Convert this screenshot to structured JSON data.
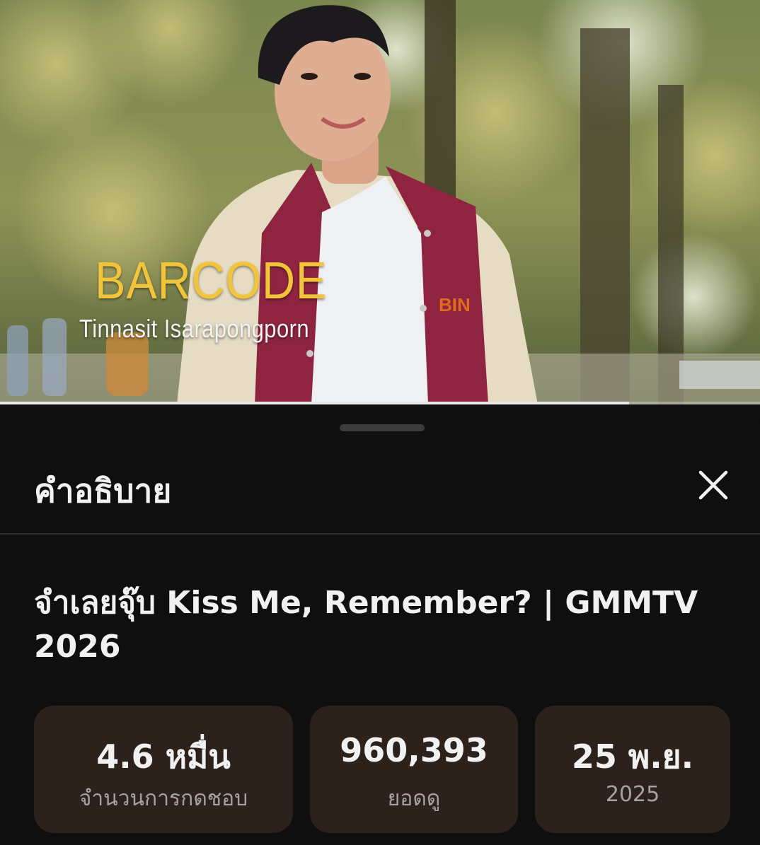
{
  "video": {
    "caption_name": "BARCODE",
    "caption_subtitle": "Tinnasit Isarapongporn",
    "jacket_text": "BIN",
    "progress_fraction": 0.828
  },
  "sheet": {
    "title": "คำอธิบาย",
    "close_icon": "close-icon",
    "video_title": "จำเลยจุ๊บ Kiss Me, Remember? | GMMTV 2026",
    "stats": {
      "likes": {
        "value": "4.6 หมื่น",
        "label": "จำนวนการกดชอบ"
      },
      "views": {
        "value": "960,393",
        "label": "ยอดดู"
      },
      "date": {
        "value": "25 พ.ย.",
        "label": "2025"
      }
    }
  },
  "colors": {
    "background": "#0f0f0f",
    "card": "#2d211c",
    "caption_gold": "#f1c43a",
    "text_primary": "#f1f1f1",
    "text_secondary": "#a6a29f"
  }
}
